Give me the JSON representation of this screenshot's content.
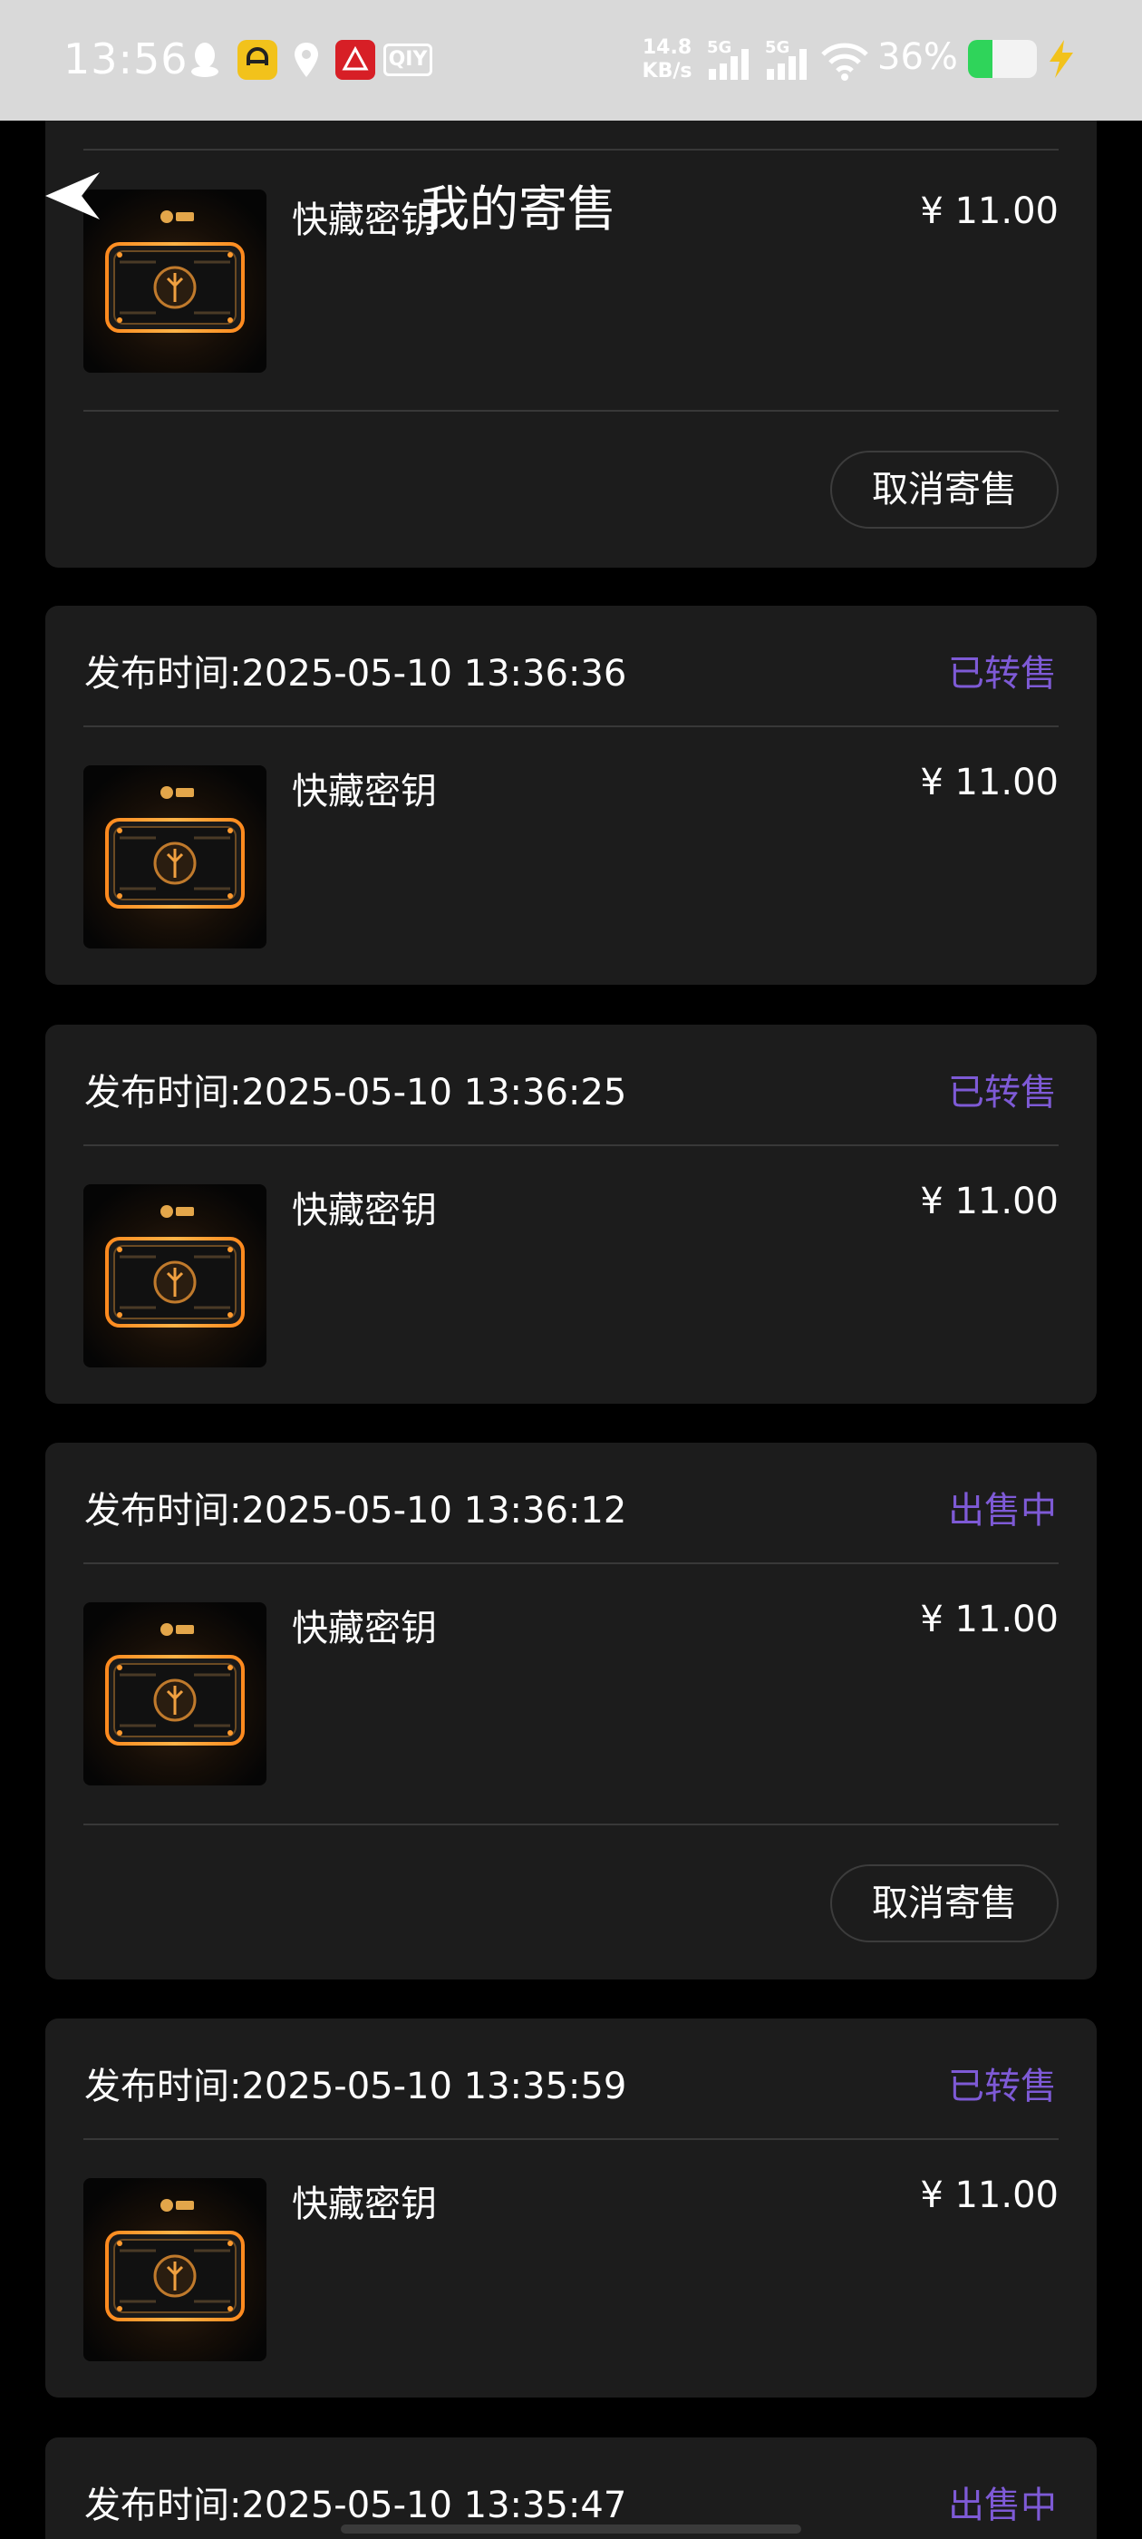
{
  "status_bar": {
    "time": "13:56",
    "icons": [
      "qq-icon",
      "app-icon",
      "map-pin-icon",
      "app-icon",
      "iqiyi-icon"
    ],
    "iqiyi_text": "QIY",
    "net_speed_value": "14.8",
    "net_speed_unit": "KB/s",
    "sim1_label": "5G",
    "sim2_label": "5G",
    "battery_percent": "36%",
    "battery_level": 0.36,
    "colors": {
      "background": "#d9d9d9",
      "battery_fill": "#2fd45a",
      "bolt": "#f2c21b"
    }
  },
  "header": {
    "title": "我的寄售"
  },
  "orders": [
    {
      "publish_time": "",
      "status": "",
      "item_name": "快藏密钥",
      "price": "¥ 11.00",
      "cancel_label": "取消寄售"
    },
    {
      "publish_time": "发布时间:2025-05-10 13:36:36",
      "status": "已转售",
      "item_name": "快藏密钥",
      "price": "¥ 11.00"
    },
    {
      "publish_time": "发布时间:2025-05-10 13:36:25",
      "status": "已转售",
      "item_name": "快藏密钥",
      "price": "¥ 11.00"
    },
    {
      "publish_time": "发布时间:2025-05-10 13:36:12",
      "status": "出售中",
      "item_name": "快藏密钥",
      "price": "¥ 11.00",
      "cancel_label": "取消寄售"
    },
    {
      "publish_time": "发布时间:2025-05-10 13:35:59",
      "status": "已转售",
      "item_name": "快藏密钥",
      "price": "¥ 11.00"
    },
    {
      "publish_time": "发布时间:2025-05-10 13:35:47",
      "status": "出售中"
    }
  ],
  "colors": {
    "page_background": "#000000",
    "card_background": "#1c1c1c",
    "status_purple": "#7e5ad6",
    "text": "#ffffff"
  }
}
